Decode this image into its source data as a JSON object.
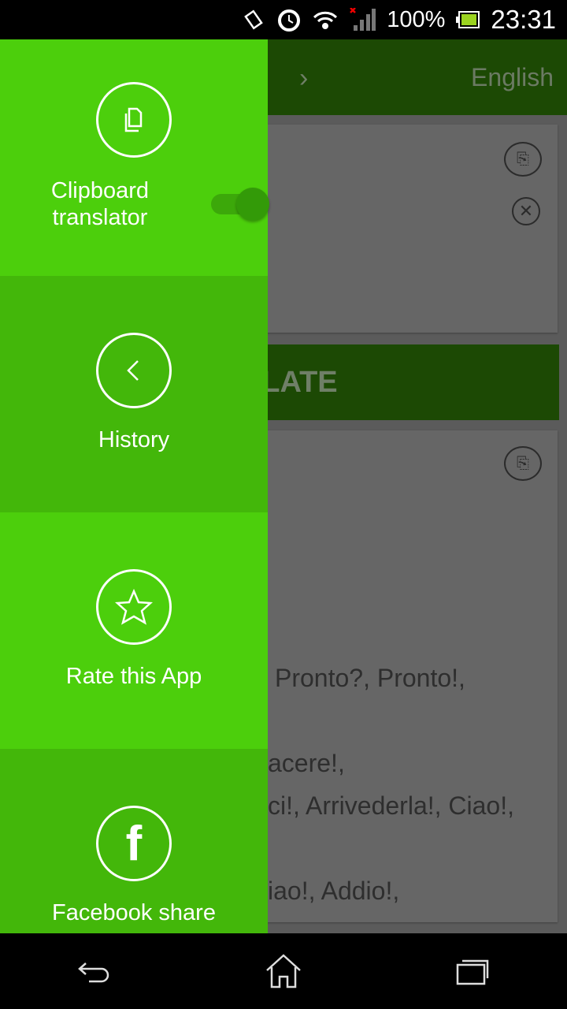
{
  "status_bar": {
    "battery": "100%",
    "time": "23:31",
    "icons": [
      "rotate-icon",
      "alarm-icon",
      "wifi-icon",
      "signal-icon",
      "battery-icon"
    ]
  },
  "toolbar": {
    "target_language": "English",
    "swap_icon": "chevron-right-icon"
  },
  "translate_button": {
    "label": "TRANSLATE",
    "visible_label": "NSLATE"
  },
  "result": {
    "lines": [
      "Pronto?, Pronto!,",
      "acere!,",
      "ci!, Arrivederla!, Ciao!,",
      "iao!, Addio!,"
    ]
  },
  "drawer": {
    "items": [
      {
        "label_line1": "Clipboard",
        "label_line2": "translator",
        "icon": "clipboard-icon",
        "toggle_on": false
      },
      {
        "label": "History",
        "icon": "chevron-left-icon"
      },
      {
        "label": "Rate this App",
        "icon": "star-icon"
      },
      {
        "label": "Facebook share",
        "icon": "facebook-icon"
      }
    ]
  },
  "colors": {
    "drawer_light": "#4ccf0c",
    "drawer_dark": "#43b70a",
    "toolbar": "#1c4904"
  }
}
